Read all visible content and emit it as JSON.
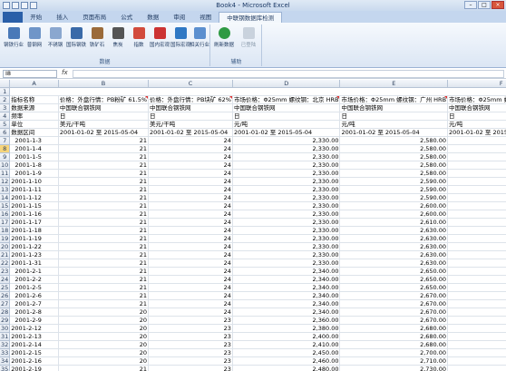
{
  "window": {
    "title": "Book4 - Microsoft Excel"
  },
  "tabs": [
    "开始",
    "插入",
    "页面布局",
    "公式",
    "数据",
    "审阅",
    "视图",
    "中联钢数据库检测"
  ],
  "active_tab": "中联钢数据库检测",
  "ribbon": {
    "group_data": {
      "label": "数据",
      "buttons": [
        "钢铁行业",
        "普钢网",
        "不锈钢",
        "国际钢铁",
        "铁矿石",
        "焦炭",
        "指数",
        "国内宏观",
        "国际宏观",
        "相关行业"
      ]
    },
    "group_aux": {
      "label": "辅助",
      "buttons": [
        "刷新数据",
        "已登陆"
      ]
    }
  },
  "formula_bar": {
    "name_box": "I8",
    "fx": "fx",
    "content": ""
  },
  "sheet": {
    "columns": [
      "A",
      "B",
      "C",
      "D",
      "E",
      "F"
    ],
    "header_rows": [
      [
        "指标名称",
        "价格：外盘行情：PB粉矿 61.5%",
        "价格：外盘行情：PB块矿 62%",
        "市场价格：Φ25mm 螺纹钢：北京 HRB",
        "市场价格：Φ25mm 螺纹钢：广州 HRB",
        "市场价格：Φ25mm 螺纹钢：上海 HRB"
      ],
      [
        "数据来源",
        "中国联合钢铁网",
        "中国联合钢铁网",
        "中国联合钢铁网",
        "中国联合钢铁网",
        "中国联合钢铁网"
      ],
      [
        "频率",
        "日",
        "日",
        "日",
        "日",
        "日"
      ],
      [
        "单位",
        "美元/干吨",
        "美元/干吨",
        "元/吨",
        "元/吨",
        "元/吨"
      ],
      [
        "数据区间",
        "2001-01-02 至 2015-05-04",
        "2001-01-02 至 2015-05-04",
        "2001-01-02 至 2015-05-04",
        "2001-01-02 至 2015-05-04",
        "2001-01-02 至 2015-05-04"
      ]
    ],
    "data_rows": [
      [
        "2001-1-3",
        "21",
        "24",
        "2,330.00",
        "2,580.00",
        "2,380.00"
      ],
      [
        "2001-1-4",
        "21",
        "24",
        "2,330.00",
        "2,580.00",
        "2,380.00"
      ],
      [
        "2001-1-5",
        "21",
        "24",
        "2,330.00",
        "2,580.00",
        "2,380.00"
      ],
      [
        "2001-1-8",
        "21",
        "24",
        "2,330.00",
        "2,580.00",
        "2,380.00"
      ],
      [
        "2001-1-9",
        "21",
        "24",
        "2,330.00",
        "2,580.00",
        "2,380.00"
      ],
      [
        "2001-1-10",
        "21",
        "24",
        "2,330.00",
        "2,590.00",
        "2,370.00"
      ],
      [
        "2001-1-11",
        "21",
        "24",
        "2,330.00",
        "2,590.00",
        "2,370.00"
      ],
      [
        "2001-1-12",
        "21",
        "24",
        "2,330.00",
        "2,590.00",
        "2,370.00"
      ],
      [
        "2001-1-15",
        "21",
        "24",
        "2,330.00",
        "2,600.00",
        "2,380.00"
      ],
      [
        "2001-1-16",
        "21",
        "24",
        "2,330.00",
        "2,600.00",
        "2,380.00"
      ],
      [
        "2001-1-17",
        "21",
        "24",
        "2,330.00",
        "2,610.00",
        "2,380.00"
      ],
      [
        "2001-1-18",
        "21",
        "24",
        "2,330.00",
        "2,630.00",
        "2,380.00"
      ],
      [
        "2001-1-19",
        "21",
        "24",
        "2,330.00",
        "2,630.00",
        "2,380.00"
      ],
      [
        "2001-1-22",
        "21",
        "24",
        "2,330.00",
        "2,630.00",
        "2,380.00"
      ],
      [
        "2001-1-23",
        "21",
        "24",
        "2,330.00",
        "2,630.00",
        "2,380.00"
      ],
      [
        "2001-1-31",
        "21",
        "24",
        "2,330.00",
        "2,630.00",
        "2,380.00"
      ],
      [
        "2001-2-1",
        "21",
        "24",
        "2,340.00",
        "2,650.00",
        "2,390.00"
      ],
      [
        "2001-2-2",
        "21",
        "24",
        "2,340.00",
        "2,650.00",
        "2,390.00"
      ],
      [
        "2001-2-5",
        "21",
        "24",
        "2,340.00",
        "2,650.00",
        "2,390.00"
      ],
      [
        "2001-2-6",
        "21",
        "24",
        "2,340.00",
        "2,670.00",
        "2,390.00"
      ],
      [
        "2001-2-7",
        "21",
        "24",
        "2,340.00",
        "2,670.00",
        "2,390.00"
      ],
      [
        "2001-2-8",
        "20",
        "24",
        "2,340.00",
        "2,670.00",
        "2,390.00"
      ],
      [
        "2001-2-9",
        "20",
        "23",
        "2,360.00",
        "2,670.00",
        "2,400.00"
      ],
      [
        "2001-2-12",
        "20",
        "23",
        "2,380.00",
        "2,680.00",
        "2,410.00"
      ],
      [
        "2001-2-13",
        "20",
        "23",
        "2,400.00",
        "2,680.00",
        "2,410.00"
      ],
      [
        "2001-2-14",
        "20",
        "23",
        "2,410.00",
        "2,680.00",
        "2,410.00"
      ],
      [
        "2001-2-15",
        "20",
        "23",
        "2,450.00",
        "2,700.00",
        "2,450.00"
      ],
      [
        "2001-2-16",
        "20",
        "23",
        "2,460.00",
        "2,710.00",
        "2,510.00"
      ],
      [
        "2001-2-19",
        "21",
        "23",
        "2,480.00",
        "2,730.00",
        "2,530.00"
      ]
    ]
  }
}
